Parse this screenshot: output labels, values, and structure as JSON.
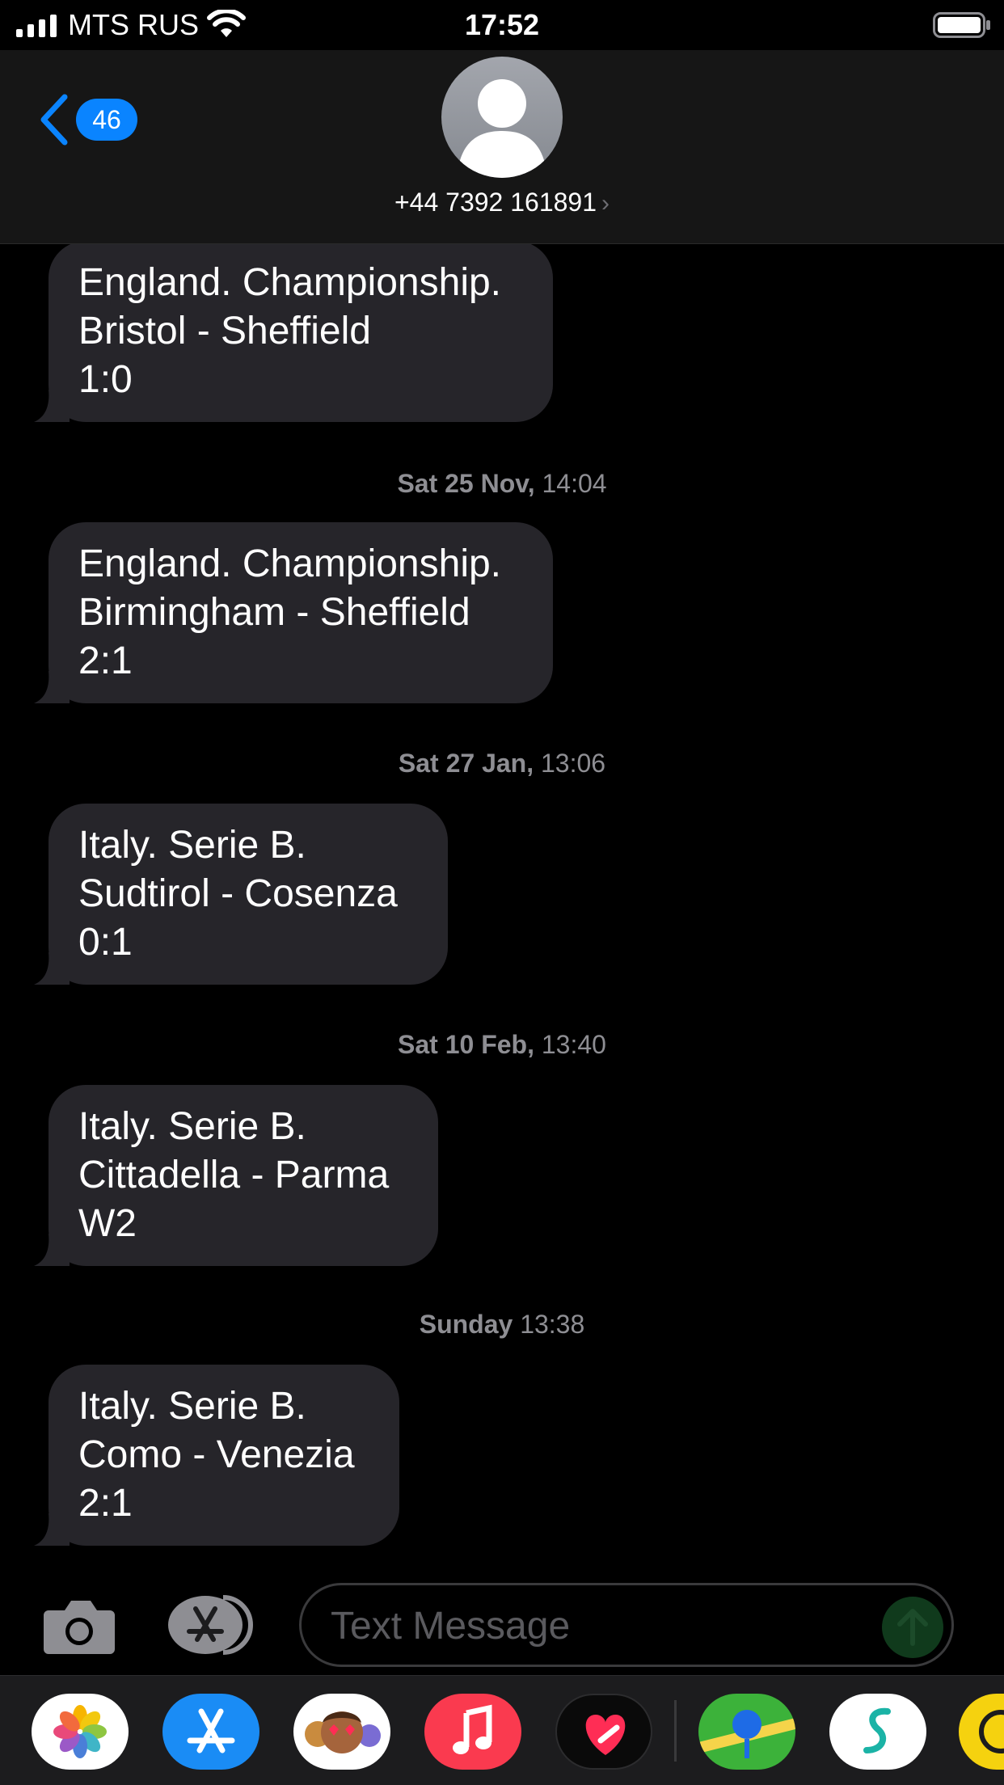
{
  "status_bar": {
    "carrier": "MTS RUS",
    "time": "17:52"
  },
  "header": {
    "back_count": "46",
    "contact": "+44 7392 161891",
    "chevron": "›"
  },
  "thread": {
    "messages": [
      {
        "lines": [
          "England. Championship.",
          "Bristol - Sheffield",
          "1:0"
        ]
      },
      {
        "timestamp_day": "Sat 25 Nov,",
        "timestamp_time": "14:04",
        "lines": [
          "England. Championship.",
          "Birmingham - Sheffield",
          "2:1"
        ]
      },
      {
        "timestamp_day": "Sat 27 Jan,",
        "timestamp_time": "13:06",
        "lines": [
          "Italy. Serie B.",
          "Sudtirol - Cosenza",
          "0:1"
        ]
      },
      {
        "timestamp_day": "Sat 10 Feb,",
        "timestamp_time": "13:40",
        "lines": [
          "Italy. Serie B.",
          "Cittadella - Parma",
          "W2"
        ]
      },
      {
        "timestamp_day": "Sunday",
        "timestamp_time": "13:38",
        "lines": [
          "Italy. Serie B.",
          "Como - Venezia",
          "2:1"
        ]
      }
    ]
  },
  "input": {
    "placeholder": "Text Message"
  },
  "app_drawer": {
    "apps": [
      "photos-app-icon",
      "app-store-app-icon",
      "memoji-app-icon",
      "music-app-icon",
      "digital-touch-app-icon",
      "maps-app-icon",
      "surfshark-app-icon",
      "yellow-app-icon"
    ]
  },
  "colors": {
    "accent": "#0a84ff",
    "bubble": "#26252a",
    "header": "#161616",
    "timestamp": "#8e8e93"
  }
}
